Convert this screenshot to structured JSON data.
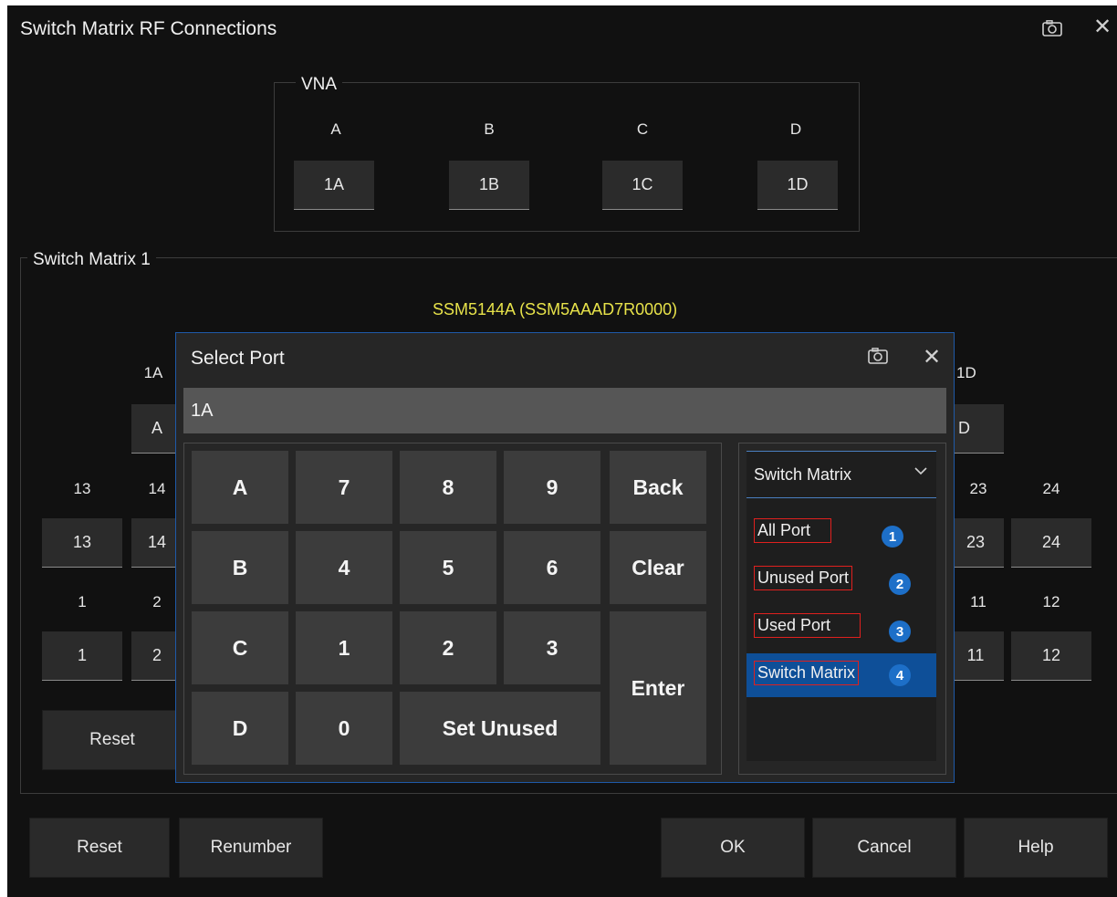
{
  "window": {
    "title": "Switch Matrix RF Connections",
    "camera_icon": "camera-icon",
    "close_icon": "close-icon",
    "close_glyph": "✕"
  },
  "vna": {
    "label": "VNA",
    "ports": [
      {
        "name": "A",
        "value": "1A"
      },
      {
        "name": "B",
        "value": "1B"
      },
      {
        "name": "C",
        "value": "1C"
      },
      {
        "name": "D",
        "value": "1D"
      }
    ]
  },
  "switch_matrix": {
    "label": "Switch Matrix 1",
    "model": "SSM5144A (SSM5AAAD7R0000)",
    "left_partial": {
      "top_label": "1A",
      "top_value": "A",
      "row1_label": [
        "13",
        "14"
      ],
      "row1_value": [
        "13",
        "14"
      ],
      "row2_label": [
        "1",
        "2"
      ],
      "row2_value": [
        "1",
        "2"
      ]
    },
    "right_partial": {
      "top_label": "1D",
      "top_value": "D",
      "row1_label": [
        "23",
        "24"
      ],
      "row1_value": [
        "23",
        "24"
      ],
      "row2_label": [
        "11",
        "12"
      ],
      "row2_value": [
        "11",
        "12"
      ]
    },
    "reset_label": "Reset"
  },
  "footer": {
    "reset": "Reset",
    "renumber": "Renumber",
    "ok": "OK",
    "cancel": "Cancel",
    "help": "Help"
  },
  "dialog": {
    "title": "Select Port",
    "field_value": "1A",
    "keys": {
      "a": "A",
      "b": "B",
      "c": "C",
      "d": "D",
      "k7": "7",
      "k8": "8",
      "k9": "9",
      "k4": "4",
      "k5": "5",
      "k6": "6",
      "k1": "1",
      "k2": "2",
      "k3": "3",
      "k0": "0",
      "back": "Back",
      "clear": "Clear",
      "enter": "Enter",
      "set_unused": "Set Unused"
    },
    "filter": {
      "selected": "Switch Matrix",
      "options": [
        {
          "label": "All Port",
          "badge": "1"
        },
        {
          "label": "Unused Port",
          "badge": "2"
        },
        {
          "label": "Used Port",
          "badge": "3"
        },
        {
          "label": "Switch Matrix",
          "badge": "4"
        }
      ],
      "highlight_color": "#0e4f98"
    }
  }
}
